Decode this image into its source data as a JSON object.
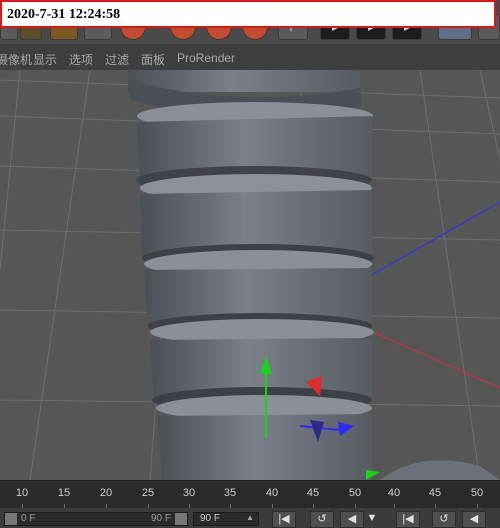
{
  "timestamp": "2020-7-31 12:24:58",
  "viewport_menu": {
    "items": [
      "摄像机",
      "显示",
      "选项",
      "过滤",
      "面板",
      "ProRender"
    ]
  },
  "timeline": {
    "ruler_ticks": [
      "10",
      "15",
      "20",
      "25",
      "30",
      "35",
      "40",
      "45",
      "50",
      "40",
      "45",
      "50"
    ],
    "range_start": "0 F",
    "range_end": "90 F",
    "current_frame": "90 F"
  },
  "icons": {
    "toolbar": [
      "render-icon",
      "tool-icon",
      "dark-button-icon"
    ],
    "playback": [
      "go-to-start-icon",
      "loop-icon",
      "play-back-icon"
    ]
  },
  "colors": {
    "axis_x": "#e02b2b",
    "axis_y": "#19d319",
    "axis_z": "#2a2aff",
    "grid": "#6e6e6e",
    "object": "#6c7179"
  }
}
